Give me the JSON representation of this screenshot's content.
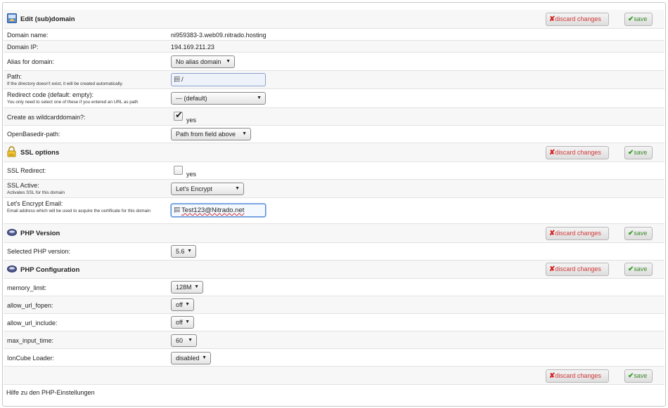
{
  "domain_section": {
    "title": "Edit (sub)domain",
    "discard_label": "discard changes",
    "save_label": "save",
    "domain_name_label": "Domain name:",
    "domain_name_value": "ni959383-3.web09.nitrado.hosting",
    "domain_ip_label": "Domain IP:",
    "domain_ip_value": "194.169.211.23",
    "alias_label": "Alias for domain:",
    "alias_value": "No alias domain",
    "path_label": "Path:",
    "path_hint": "If the directory doesn't exist, it will be created automatically.",
    "path_value": "/",
    "redirect_label": "Redirect code (default: empty):",
    "redirect_hint": "You only need to select one of these if you entered an URL as path",
    "redirect_value": "--- (default)",
    "wildcard_label": "Create as wildcarddomain?:",
    "wildcard_option": "yes",
    "wildcard_checked": true,
    "openbasedir_label": "OpenBasedir-path:",
    "openbasedir_value": "Path from field above"
  },
  "ssl_section": {
    "title": "SSL options",
    "discard_label": "discard changes",
    "save_label": "save",
    "redirect_label": "SSL Redirect:",
    "redirect_option": "yes",
    "redirect_checked": false,
    "active_label": "SSL Active:",
    "active_hint": "Activates SSL for this domain",
    "active_value": "Let's Encrypt",
    "email_label": "Let's Encrypt Email:",
    "email_hint": "Email address which will be used to acquire the certificate for this domain",
    "email_value": "Test123@Nitrado.net"
  },
  "php_version_section": {
    "title": "PHP Version",
    "discard_label": "discard changes",
    "save_label": "save",
    "selected_label": "Selected PHP version:",
    "selected_value": "5.6"
  },
  "php_config_section": {
    "title": "PHP Configuration",
    "discard_label": "discard changes",
    "save_label": "save",
    "memory_limit_label": "memory_limit:",
    "memory_limit_value": "128M",
    "allow_url_fopen_label": "allow_url_fopen:",
    "allow_url_fopen_value": "off",
    "allow_url_include_label": "allow_url_include:",
    "allow_url_include_value": "off",
    "max_input_time_label": "max_input_time:",
    "max_input_time_value": "60",
    "ioncube_label": "IonCube Loader:",
    "ioncube_value": "disabled"
  },
  "footer": {
    "discard_label": "discard changes",
    "save_label": "save",
    "help_link": "Hilfe zu den PHP-Einstellungen"
  },
  "colors": {
    "discard_text": "#d23a3a",
    "save_text": "#3a8a2a",
    "input_bg": "#eef3fb"
  }
}
